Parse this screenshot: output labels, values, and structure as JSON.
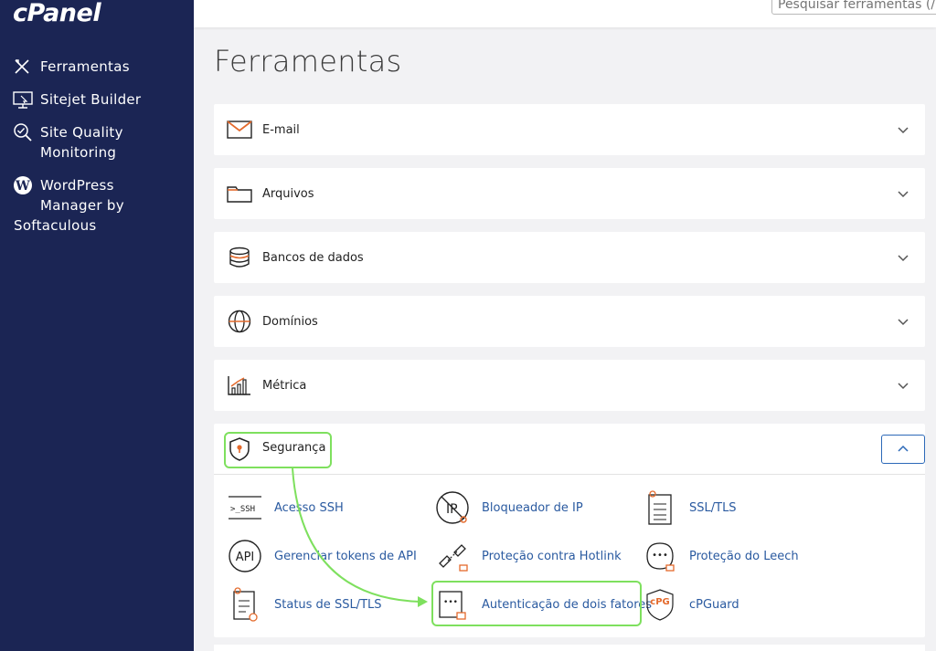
{
  "sidebar": {
    "logo": "cPanel",
    "items": [
      {
        "label": "Ferramentas",
        "icon": "tools-icon"
      },
      {
        "label": "Sitejet Builder",
        "icon": "sitejet-icon"
      },
      {
        "label_line1": "Site Quality",
        "label_line2": "Monitoring",
        "icon": "site-quality-icon"
      },
      {
        "label_line1": "WordPress",
        "label_line2": "Manager by",
        "label_line3": "Softaculous",
        "icon": "wordpress-icon"
      }
    ]
  },
  "header": {
    "search_placeholder": "Pesquisar ferramentas (/)"
  },
  "main": {
    "title": "Ferramentas",
    "categories": [
      {
        "label": "E-mail",
        "icon": "email-icon"
      },
      {
        "label": "Arquivos",
        "icon": "folder-icon"
      },
      {
        "label": "Bancos de dados",
        "icon": "database-icon"
      },
      {
        "label": "Domínios",
        "icon": "globe-icon"
      },
      {
        "label": "Métrica",
        "icon": "metrics-icon"
      }
    ],
    "security": {
      "label": "Segurança",
      "icon": "shield-icon",
      "tools": [
        {
          "label": "Acesso SSH",
          "icon": "ssh-icon",
          "icon_text": ">_SSH"
        },
        {
          "label": "Bloqueador de IP",
          "icon": "ip-blocker-icon",
          "icon_text": "IP"
        },
        {
          "label": "SSL/TLS",
          "icon": "ssl-tls-icon"
        },
        {
          "label": "Gerenciar tokens de API",
          "icon": "api-icon",
          "icon_text": "API"
        },
        {
          "label": "Proteção contra Hotlink",
          "icon": "hotlink-icon"
        },
        {
          "label": "Proteção do Leech",
          "icon": "leech-icon",
          "icon_text": "•••"
        },
        {
          "label": "Status de SSL/TLS",
          "icon": "ssl-status-icon"
        },
        {
          "label": "Autenticação de dois fatores",
          "icon": "two-factor-icon",
          "icon_text": "•••"
        },
        {
          "label": "cPGuard",
          "icon": "cpguard-icon",
          "icon_text": "cPG"
        }
      ]
    }
  },
  "colors": {
    "sidebar_bg": "#1b2554",
    "accent": "#e46a2c",
    "link": "#2a5aa0",
    "highlight": "#7ee05e"
  }
}
